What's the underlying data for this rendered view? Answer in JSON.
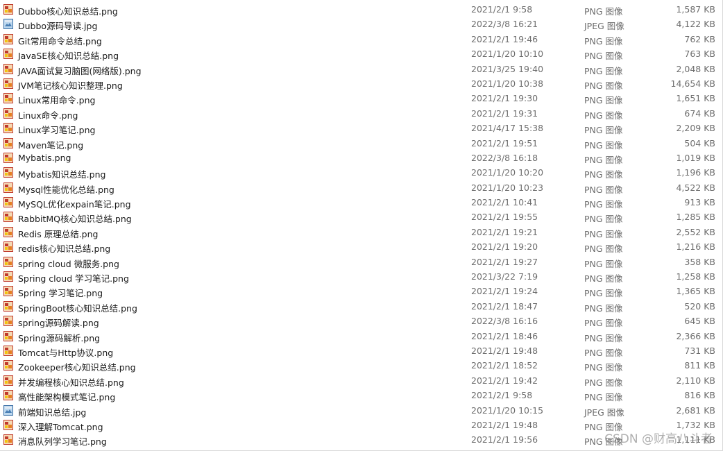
{
  "files": [
    {
      "name": "Dubbo核心知识总结.png",
      "date": "2021/2/1 9:58",
      "type": "PNG 图像",
      "size": "1,587 KB",
      "icon": "png-file-icon"
    },
    {
      "name": "Dubbo源码导读.jpg",
      "date": "2022/3/8 16:21",
      "type": "JPEG 图像",
      "size": "4,122 KB",
      "icon": "jpeg-file-icon"
    },
    {
      "name": "Git常用命令总结.png",
      "date": "2021/2/1 19:46",
      "type": "PNG 图像",
      "size": "762 KB",
      "icon": "png-file-icon"
    },
    {
      "name": "JavaSE核心知识总结.png",
      "date": "2021/1/20 10:10",
      "type": "PNG 图像",
      "size": "763 KB",
      "icon": "png-file-icon"
    },
    {
      "name": "JAVA面试复习脑图(网络版).png",
      "date": "2021/3/25 19:40",
      "type": "PNG 图像",
      "size": "2,048 KB",
      "icon": "png-file-icon"
    },
    {
      "name": "JVM笔记核心知识整理.png",
      "date": "2021/1/20 10:38",
      "type": "PNG 图像",
      "size": "14,654 KB",
      "icon": "png-file-icon"
    },
    {
      "name": "Linux常用命令.png",
      "date": "2021/2/1 19:30",
      "type": "PNG 图像",
      "size": "1,651 KB",
      "icon": "png-file-icon"
    },
    {
      "name": "Linux命令.png",
      "date": "2021/2/1 19:31",
      "type": "PNG 图像",
      "size": "674 KB",
      "icon": "png-file-icon"
    },
    {
      "name": "Linux学习笔记.png",
      "date": "2021/4/17 15:38",
      "type": "PNG 图像",
      "size": "2,209 KB",
      "icon": "png-file-icon"
    },
    {
      "name": "Maven笔记.png",
      "date": "2021/2/1 19:51",
      "type": "PNG 图像",
      "size": "504 KB",
      "icon": "png-file-icon"
    },
    {
      "name": "Mybatis.png",
      "date": "2022/3/8 16:18",
      "type": "PNG 图像",
      "size": "1,019 KB",
      "icon": "png-file-icon"
    },
    {
      "name": "Mybatis知识总结.png",
      "date": "2021/1/20 10:20",
      "type": "PNG 图像",
      "size": "1,196 KB",
      "icon": "png-file-icon"
    },
    {
      "name": "Mysql性能优化总结.png",
      "date": "2021/1/20 10:23",
      "type": "PNG 图像",
      "size": "4,522 KB",
      "icon": "png-file-icon"
    },
    {
      "name": "MySQL优化expain笔记.png",
      "date": "2021/2/1 10:41",
      "type": "PNG 图像",
      "size": "913 KB",
      "icon": "png-file-icon"
    },
    {
      "name": "RabbitMQ核心知识总结.png",
      "date": "2021/2/1 19:55",
      "type": "PNG 图像",
      "size": "1,285 KB",
      "icon": "png-file-icon"
    },
    {
      "name": "Redis 原理总结.png",
      "date": "2021/2/1 19:21",
      "type": "PNG 图像",
      "size": "2,552 KB",
      "icon": "png-file-icon"
    },
    {
      "name": "redis核心知识总结.png",
      "date": "2021/2/1 19:20",
      "type": "PNG 图像",
      "size": "1,216 KB",
      "icon": "png-file-icon"
    },
    {
      "name": "spring cloud 微服务.png",
      "date": "2021/2/1 19:27",
      "type": "PNG 图像",
      "size": "358 KB",
      "icon": "png-file-icon"
    },
    {
      "name": "Spring cloud 学习笔记.png",
      "date": "2021/3/22 7:19",
      "type": "PNG 图像",
      "size": "1,258 KB",
      "icon": "png-file-icon"
    },
    {
      "name": "Spring 学习笔记.png",
      "date": "2021/2/1 19:24",
      "type": "PNG 图像",
      "size": "1,365 KB",
      "icon": "png-file-icon"
    },
    {
      "name": "SpringBoot核心知识总结.png",
      "date": "2021/2/1 18:47",
      "type": "PNG 图像",
      "size": "520 KB",
      "icon": "png-file-icon"
    },
    {
      "name": "spring源码解读.png",
      "date": "2022/3/8 16:16",
      "type": "PNG 图像",
      "size": "645 KB",
      "icon": "png-file-icon"
    },
    {
      "name": "Spring源码解析.png",
      "date": "2021/2/1 18:46",
      "type": "PNG 图像",
      "size": "2,366 KB",
      "icon": "png-file-icon"
    },
    {
      "name": "Tomcat与Http协议.png",
      "date": "2021/2/1 19:48",
      "type": "PNG 图像",
      "size": "731 KB",
      "icon": "png-file-icon"
    },
    {
      "name": "Zookeeper核心知识总结.png",
      "date": "2021/2/1 18:52",
      "type": "PNG 图像",
      "size": "811 KB",
      "icon": "png-file-icon"
    },
    {
      "name": "并发编程核心知识总结.png",
      "date": "2021/2/1 19:42",
      "type": "PNG 图像",
      "size": "2,110 KB",
      "icon": "png-file-icon"
    },
    {
      "name": "高性能架构模式笔记.png",
      "date": "2021/2/1 9:58",
      "type": "PNG 图像",
      "size": "816 KB",
      "icon": "png-file-icon"
    },
    {
      "name": "前端知识总结.jpg",
      "date": "2021/1/20 10:15",
      "type": "JPEG 图像",
      "size": "2,681 KB",
      "icon": "jpeg-file-icon"
    },
    {
      "name": "深入理解Tomcat.png",
      "date": "2021/2/1 19:48",
      "type": "PNG 图像",
      "size": "1,732 KB",
      "icon": "png-file-icon"
    },
    {
      "name": "消息队列学习笔记.png",
      "date": "2021/2/1 19:56",
      "type": "PNG 图像",
      "size": "1,111 KB",
      "icon": "png-file-icon"
    }
  ],
  "colors": {
    "png_icon_border": "#c0392b",
    "png_icon_fill": "#f5d9b5",
    "jpeg_icon_border": "#3a6ea5",
    "jpeg_icon_fill": "#bcd7ee",
    "secondary_text": "#6d6d6d"
  },
  "watermark": "CSDN @财高八斗者"
}
